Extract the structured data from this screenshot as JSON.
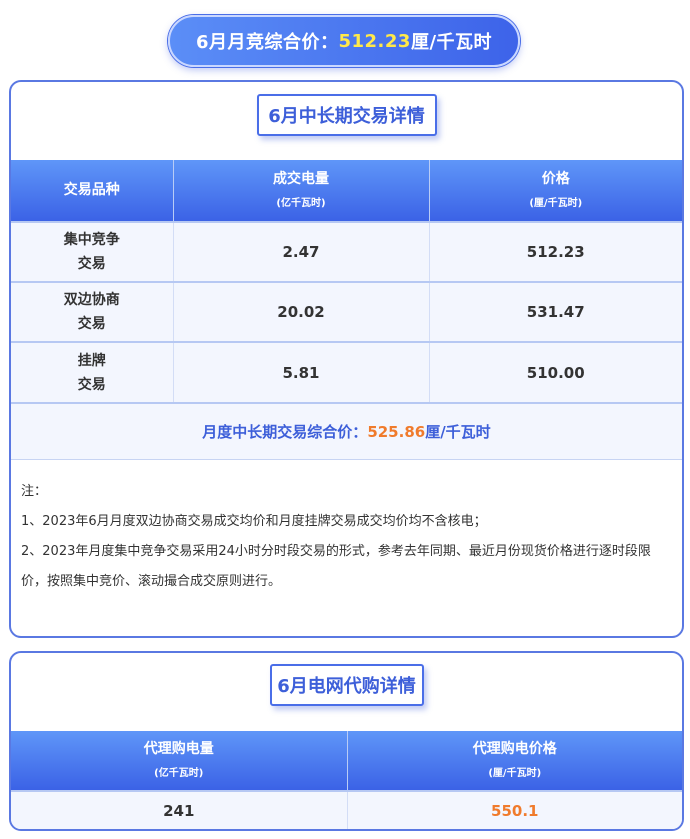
{
  "banner": {
    "prefix": "6月月竞综合价：",
    "value": "512.23",
    "unit": "厘/千瓦时"
  },
  "section1": {
    "title": "6月中长期交易详情",
    "headers": {
      "col1": "交易品种",
      "col2": "成交电量",
      "col2_unit": "(亿千瓦时)",
      "col3": "价格",
      "col3_unit": "(厘/千瓦时)"
    },
    "rows": [
      {
        "name_line1": "集中竞争",
        "name_line2": "交易",
        "volume": "2.47",
        "price": "512.23"
      },
      {
        "name_line1": "双边协商",
        "name_line2": "交易",
        "volume": "20.02",
        "price": "531.47"
      },
      {
        "name_line1": "挂牌",
        "name_line2": "交易",
        "volume": "5.81",
        "price": "510.00"
      }
    ],
    "summary": {
      "prefix": "月度中长期交易综合价：",
      "value": "525.86",
      "unit": "厘/千瓦时"
    },
    "notes": {
      "heading": "注：",
      "line1": "1、2023年6月月度双边协商交易成交均价和月度挂牌交易成交均价均不含核电；",
      "line2": "2、2023年月度集中竞争交易采用24小时分时段交易的形式，参考去年同期、最近月份现货价格进行逐时段限价，按照集中竞价、滚动撮合成交原则进行。"
    }
  },
  "section2": {
    "title": "6月电网代购详情",
    "headers": {
      "col1": "代理购电量",
      "col1_unit": "(亿千瓦时)",
      "col2": "代理购电价格",
      "col2_unit": "(厘/千瓦时)"
    },
    "row": {
      "volume": "241",
      "price": "550.1"
    }
  },
  "colors": {
    "accent_blue": "#3d63e9",
    "highlight_yellow": "#ffe94a",
    "highlight_orange": "#f07b2c"
  }
}
